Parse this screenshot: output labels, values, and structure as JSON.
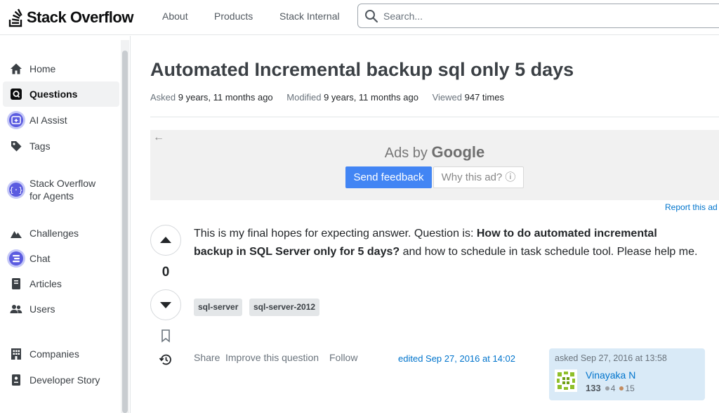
{
  "header": {
    "logo_text": "Stack Overflow",
    "nav": [
      "About",
      "Products",
      "Stack Internal"
    ],
    "search_placeholder": "Search..."
  },
  "sidebar": {
    "items": [
      {
        "label": "Home",
        "icon": "home-icon"
      },
      {
        "label": "Questions",
        "icon": "questions-icon",
        "active": true
      },
      {
        "label": "AI Assist",
        "icon": "ai-assist-icon"
      },
      {
        "label": "Tags",
        "icon": "tag-icon"
      },
      {
        "label": "Stack Overflow for Agents",
        "icon": "agents-icon"
      },
      {
        "label": "Challenges",
        "icon": "challenges-icon"
      },
      {
        "label": "Chat",
        "icon": "chat-icon"
      },
      {
        "label": "Articles",
        "icon": "articles-icon"
      },
      {
        "label": "Users",
        "icon": "users-icon"
      },
      {
        "label": "Companies",
        "icon": "companies-icon"
      },
      {
        "label": "Developer Story",
        "icon": "developer-story-icon"
      }
    ]
  },
  "question": {
    "title": "Automated Incremental backup sql only 5 days",
    "asked_label": "Asked",
    "asked_value": "9 years, 11 months ago",
    "modified_label": "Modified",
    "modified_value": "9 years, 11 months ago",
    "viewed_label": "Viewed",
    "viewed_value": "947 times",
    "vote_count": "0",
    "body_intro": "This is my final hopes for expecting answer. Question is: ",
    "body_bold": "How to do automated incremental backup in SQL Server only for 5 days?",
    "body_outro": " and how to schedule in task schedule tool. Please help me.",
    "tags": [
      "sql-server",
      "sql-server-2012"
    ],
    "actions": [
      "Share",
      "Improve this question",
      "Follow"
    ],
    "edited": "edited Sep 27, 2016 at 14:02",
    "owner": {
      "asked": "asked Sep 27, 2016 at 13:58",
      "name": "Vinayaka N",
      "reputation": "133",
      "silver_badges": "4",
      "bronze_badges": "15"
    }
  },
  "ad": {
    "ads_by": "Ads by",
    "google": "Google",
    "send_feedback": "Send feedback",
    "why_this_ad": "Why this ad? ⓘ",
    "report": "Report this ad"
  },
  "colors": {
    "accent": "#f48024",
    "link": "#0074cc",
    "owner_bg": "#d9eaf7",
    "ad_button": "#4285f4"
  }
}
